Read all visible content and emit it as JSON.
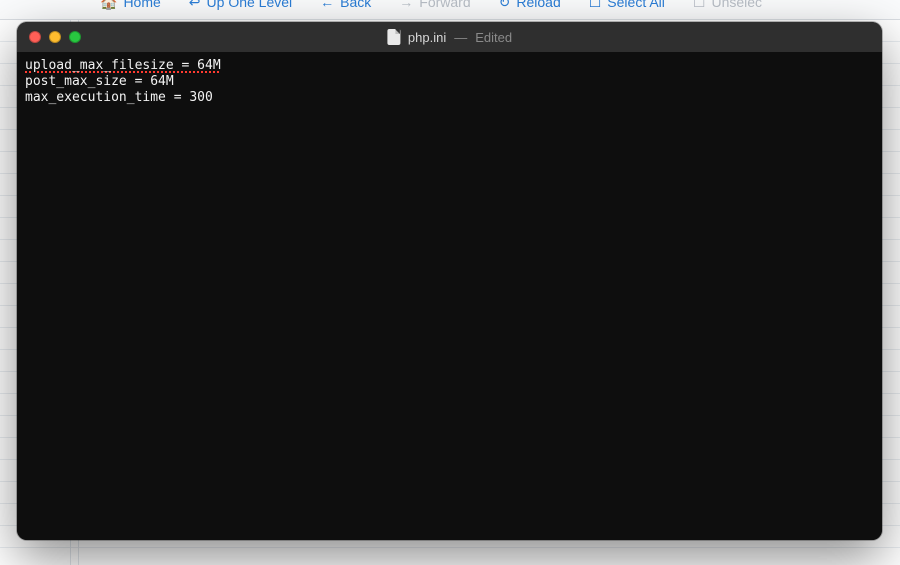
{
  "bg_toolbar": {
    "items": [
      {
        "icon": "🏠",
        "label": "Home",
        "muted": false
      },
      {
        "icon": "↩",
        "label": "Up One Level",
        "muted": false
      },
      {
        "icon": "←",
        "label": "Back",
        "muted": false
      },
      {
        "icon": "→",
        "label": "Forward",
        "muted": true
      },
      {
        "icon": "↻",
        "label": "Reload",
        "muted": false
      },
      {
        "icon": "☐",
        "label": "Select All",
        "muted": false
      },
      {
        "icon": "☐",
        "label": "Unselec",
        "muted": true
      }
    ]
  },
  "window": {
    "filename": "php.ini",
    "status": "Edited"
  },
  "editor": {
    "lines": [
      {
        "text": "upload_max_filesize = 64M",
        "spell": true
      },
      {
        "text": "post_max_size = 64M",
        "spell": false
      },
      {
        "text": "max_execution_time = 300",
        "spell": false
      }
    ]
  }
}
